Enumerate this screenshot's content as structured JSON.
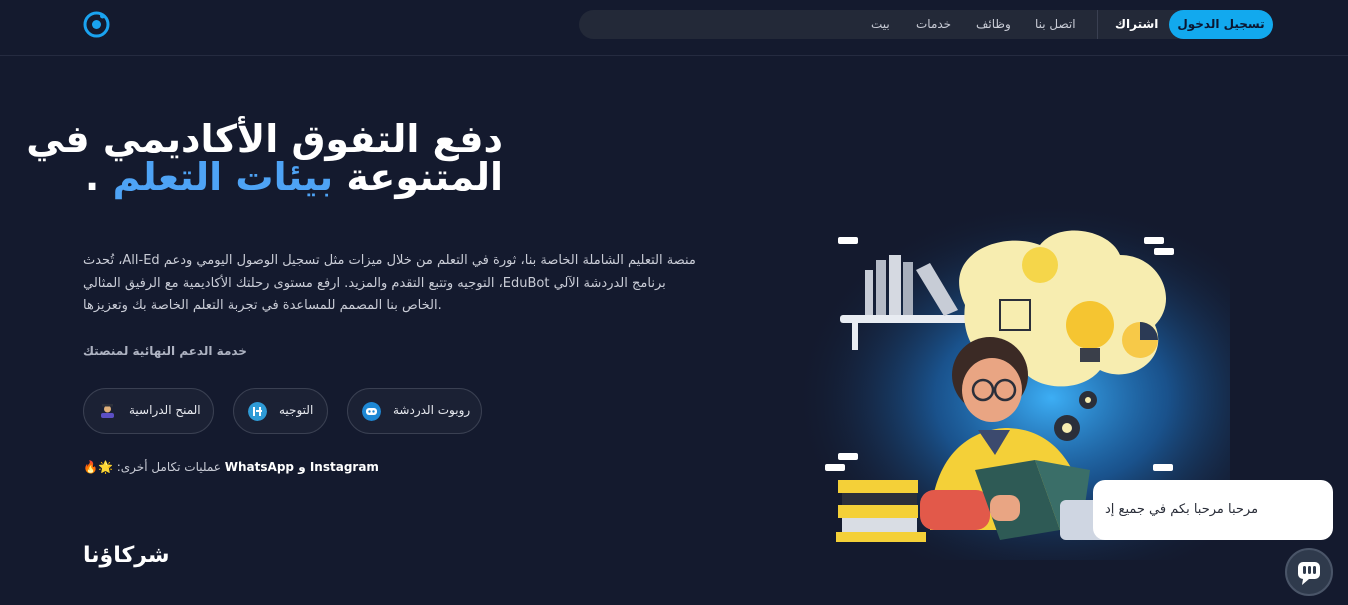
{
  "nav": {
    "home": "بيت",
    "services": "خدمات",
    "jobs": "وظائف",
    "contact": "اتصل بنا",
    "signup": "اشتراك",
    "login": "تسجيل الدخول"
  },
  "hero": {
    "title_line1": "دفع التفوق الأكاديمي في",
    "title_line2_plain": "المتنوعة",
    "title_line2_accent": "بيئات التعلم",
    "title_line2_dot": ".",
    "desc_line1": "منصة التعليم الشاملة الخاصة بنا، ثورة في التعلم من خلال ميزات مثل تسجيل الوصول اليومي ودعم All-Ed، تُحدث",
    "desc_line2": "برنامج الدردشة الآلي EduBot، التوجيه وتتبع التقدم والمزيد. ارفع مستوى رحلتك الأكاديمية مع الرفيق المثالي",
    "desc_line3": ".الخاص بنا المصمم للمساعدة في تجربة التعلم الخاصة بك وتعزيزها",
    "support_label": "خدمة الدعم النهائية لمنصتك"
  },
  "features": [
    {
      "label": "المنح الدراسية",
      "icon": "scholarship-icon"
    },
    {
      "label": "التوجيه",
      "icon": "mentoring-icon"
    },
    {
      "label": "روبوت الدردشة",
      "icon": "chatbot-icon"
    }
  ],
  "integrations": {
    "prefix": ":عمليات تكامل أخرى",
    "names": "WhatsApp و Instagram",
    "emoji": "🔥🌟"
  },
  "partners_title": "شركاؤنا",
  "chat": {
    "bubble_text": "مرحبا مرحبا بكم في جميع إد"
  },
  "colors": {
    "background": "#141a2e",
    "accent": "#4ea3f5",
    "button": "#12a9ee"
  }
}
